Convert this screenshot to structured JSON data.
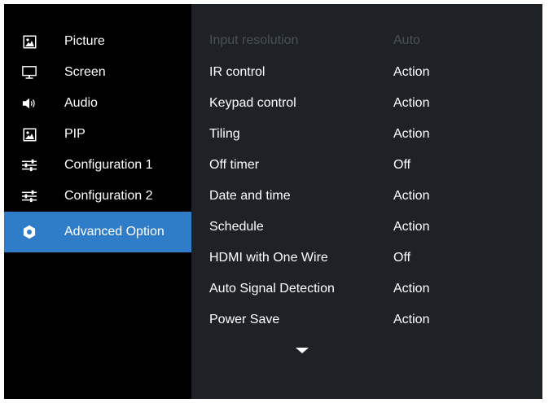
{
  "sidebar": {
    "items": [
      {
        "label": "Picture",
        "icon": "picture-icon"
      },
      {
        "label": "Screen",
        "icon": "monitor-icon"
      },
      {
        "label": "Audio",
        "icon": "speaker-icon"
      },
      {
        "label": "PIP",
        "icon": "pip-icon"
      },
      {
        "label": "Configuration 1",
        "icon": "sliders-icon"
      },
      {
        "label": "Configuration 2",
        "icon": "sliders-icon"
      },
      {
        "label": "Advanced Option",
        "icon": "gear-icon",
        "selected": true
      }
    ]
  },
  "settings": {
    "rows": [
      {
        "name": "Input resolution",
        "value": "Auto",
        "disabled": true
      },
      {
        "name": "IR control",
        "value": "Action"
      },
      {
        "name": "Keypad control",
        "value": "Action"
      },
      {
        "name": "Tiling",
        "value": "Action"
      },
      {
        "name": "Off timer",
        "value": "Off"
      },
      {
        "name": "Date and time",
        "value": "Action"
      },
      {
        "name": "Schedule",
        "value": "Action"
      },
      {
        "name": "HDMI with One Wire",
        "value": "Off"
      },
      {
        "name": "Auto Signal Detection",
        "value": "Action"
      },
      {
        "name": "Power Save",
        "value": "Action"
      }
    ],
    "scroll_indicator": "chevron-down-icon"
  },
  "colors": {
    "sidebar_bg": "#000000",
    "panel_bg": "#1e2226",
    "active": "#2f7dc8",
    "text": "#ffffff",
    "disabled_text": "#4a5056"
  }
}
